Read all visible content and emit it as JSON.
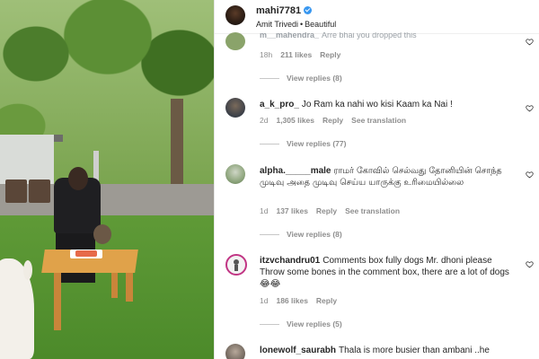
{
  "post": {
    "username": "mahi7781",
    "subtitle_user": "Amit Trivedi",
    "subtitle_song": "Beautiful",
    "more_icon": "more-horizontal-icon"
  },
  "comments": [
    {
      "username": "m__mahendra_",
      "text": "Arre bhai you dropped this",
      "time": "18h",
      "likes": "211 likes",
      "reply": "Reply",
      "translate": "",
      "view_replies": "View replies (8)"
    },
    {
      "username": "a_k_pro_",
      "text": "Jo Ram ka nahi wo kisi Kaam ka Nai !",
      "time": "2d",
      "likes": "1,305 likes",
      "reply": "Reply",
      "translate": "See translation",
      "view_replies": "View replies (77)"
    },
    {
      "username": "alpha._____male",
      "text": "ராமர் கோவில் செல்வது தோனியின் சொந்த முடிவு அதை முடிவு செய்ய யாருக்கு உரிமையில்லை",
      "time": "1d",
      "likes": "137 likes",
      "reply": "Reply",
      "translate": "See translation",
      "view_replies": "View replies (8)"
    },
    {
      "username": "itzvchandru01",
      "text": "Comments box fully dogs Mr. dhoni please Throw some bones in the comment box, there are a lot of dogs 😂😂",
      "time": "1d",
      "likes": "186 likes",
      "reply": "Reply",
      "translate": "",
      "view_replies": "View replies (5)"
    },
    {
      "username": "lonewolf_saurabh",
      "text": "Thala is more busier than ambani ..he",
      "time": "",
      "likes": "",
      "reply": "",
      "translate": "",
      "view_replies": ""
    }
  ]
}
